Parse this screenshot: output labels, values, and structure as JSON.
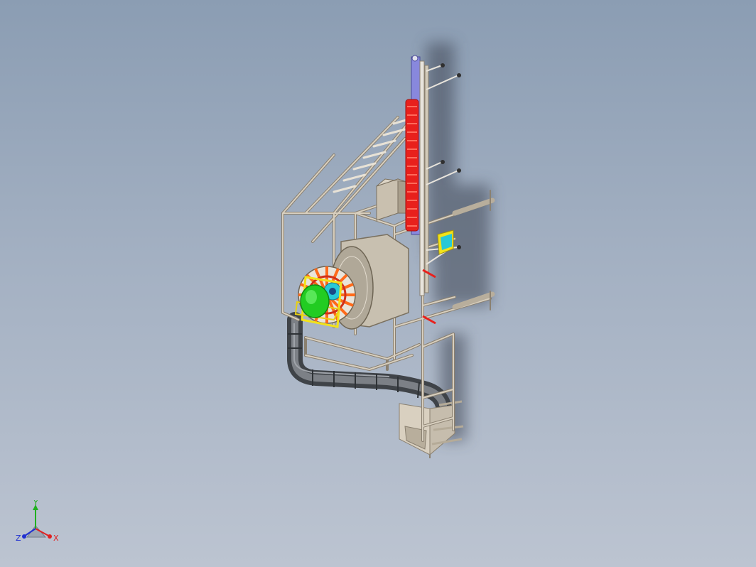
{
  "viewport": {
    "background_top": "#8b9db3",
    "background_bottom": "#bcc4d1"
  },
  "model": {
    "frame_color": "#cfc6b6",
    "frame_edge_color": "#8a8070",
    "accent_red": "#e8201c",
    "accent_green": "#22cc22",
    "accent_yellow": "#f2e21a",
    "accent_orange": "#ff7a20",
    "accent_cyan": "#28c8d8",
    "accent_blue": "#8888dd",
    "duct_color": "#5a5e64"
  },
  "triad": {
    "x_label": "X",
    "y_label": "Y",
    "z_label": "Z",
    "x_color": "#e02020",
    "y_color": "#20b020",
    "z_color": "#2030d0"
  }
}
